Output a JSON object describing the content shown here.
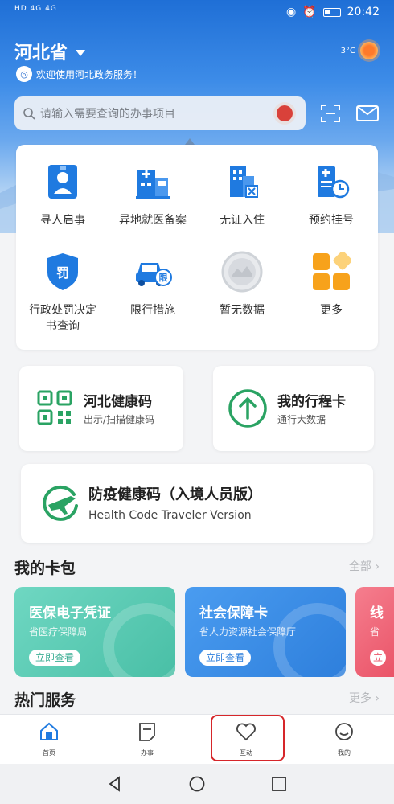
{
  "status_bar": {
    "left": "HD 4G 4G",
    "time": "20:42"
  },
  "header": {
    "region": "河北省",
    "welcome": "欢迎使用河北政务服务！",
    "temperature": "3°C"
  },
  "search": {
    "placeholder": "请输入需要查询的办事项目"
  },
  "services": [
    {
      "label": "寻人启事",
      "icon": "person-id-icon"
    },
    {
      "label": "异地就医备案",
      "icon": "hospital-icon"
    },
    {
      "label": "无证入住",
      "icon": "hotel-icon"
    },
    {
      "label": "预约挂号",
      "icon": "appointment-icon"
    },
    {
      "label": "行政处罚决定书查询",
      "icon": "penalty-shield-icon",
      "line1": "行政处罚决定",
      "line2": "书查询"
    },
    {
      "label": "限行措施",
      "icon": "car-restriction-icon",
      "badge": "限"
    },
    {
      "label": "暂无数据",
      "icon": "placeholder-emblem-icon"
    },
    {
      "label": "更多",
      "icon": "more-grid-icon"
    }
  ],
  "penalty_badge": "罚",
  "health_code": {
    "title": "河北健康码",
    "subtitle": "出示/扫描健康码"
  },
  "trip_card": {
    "title": "我的行程卡",
    "subtitle": "通行大数据"
  },
  "traveler_code": {
    "title": "防疫健康码（入境人员版）",
    "subtitle": "Health Code Traveler Version"
  },
  "wallet": {
    "title": "我的卡包",
    "more": "全部",
    "cards": [
      {
        "title": "医保电子凭证",
        "subtitle": "省医疗保障局",
        "button": "立即查看",
        "color": "#5ccdb5"
      },
      {
        "title": "社会保障卡",
        "subtitle": "省人力资源社会保障厅",
        "button": "立即查看",
        "color": "#3a8fe3"
      },
      {
        "title": "线",
        "subtitle": "省",
        "button": "立",
        "color": "#f0667a"
      }
    ]
  },
  "hot_services": {
    "title": "热门服务",
    "more": "更多"
  },
  "tabs": [
    {
      "label": "首页",
      "icon": "home-icon"
    },
    {
      "label": "办事",
      "icon": "document-icon"
    },
    {
      "label": "互动",
      "icon": "heart-icon"
    },
    {
      "label": "我的",
      "icon": "smile-icon"
    }
  ]
}
